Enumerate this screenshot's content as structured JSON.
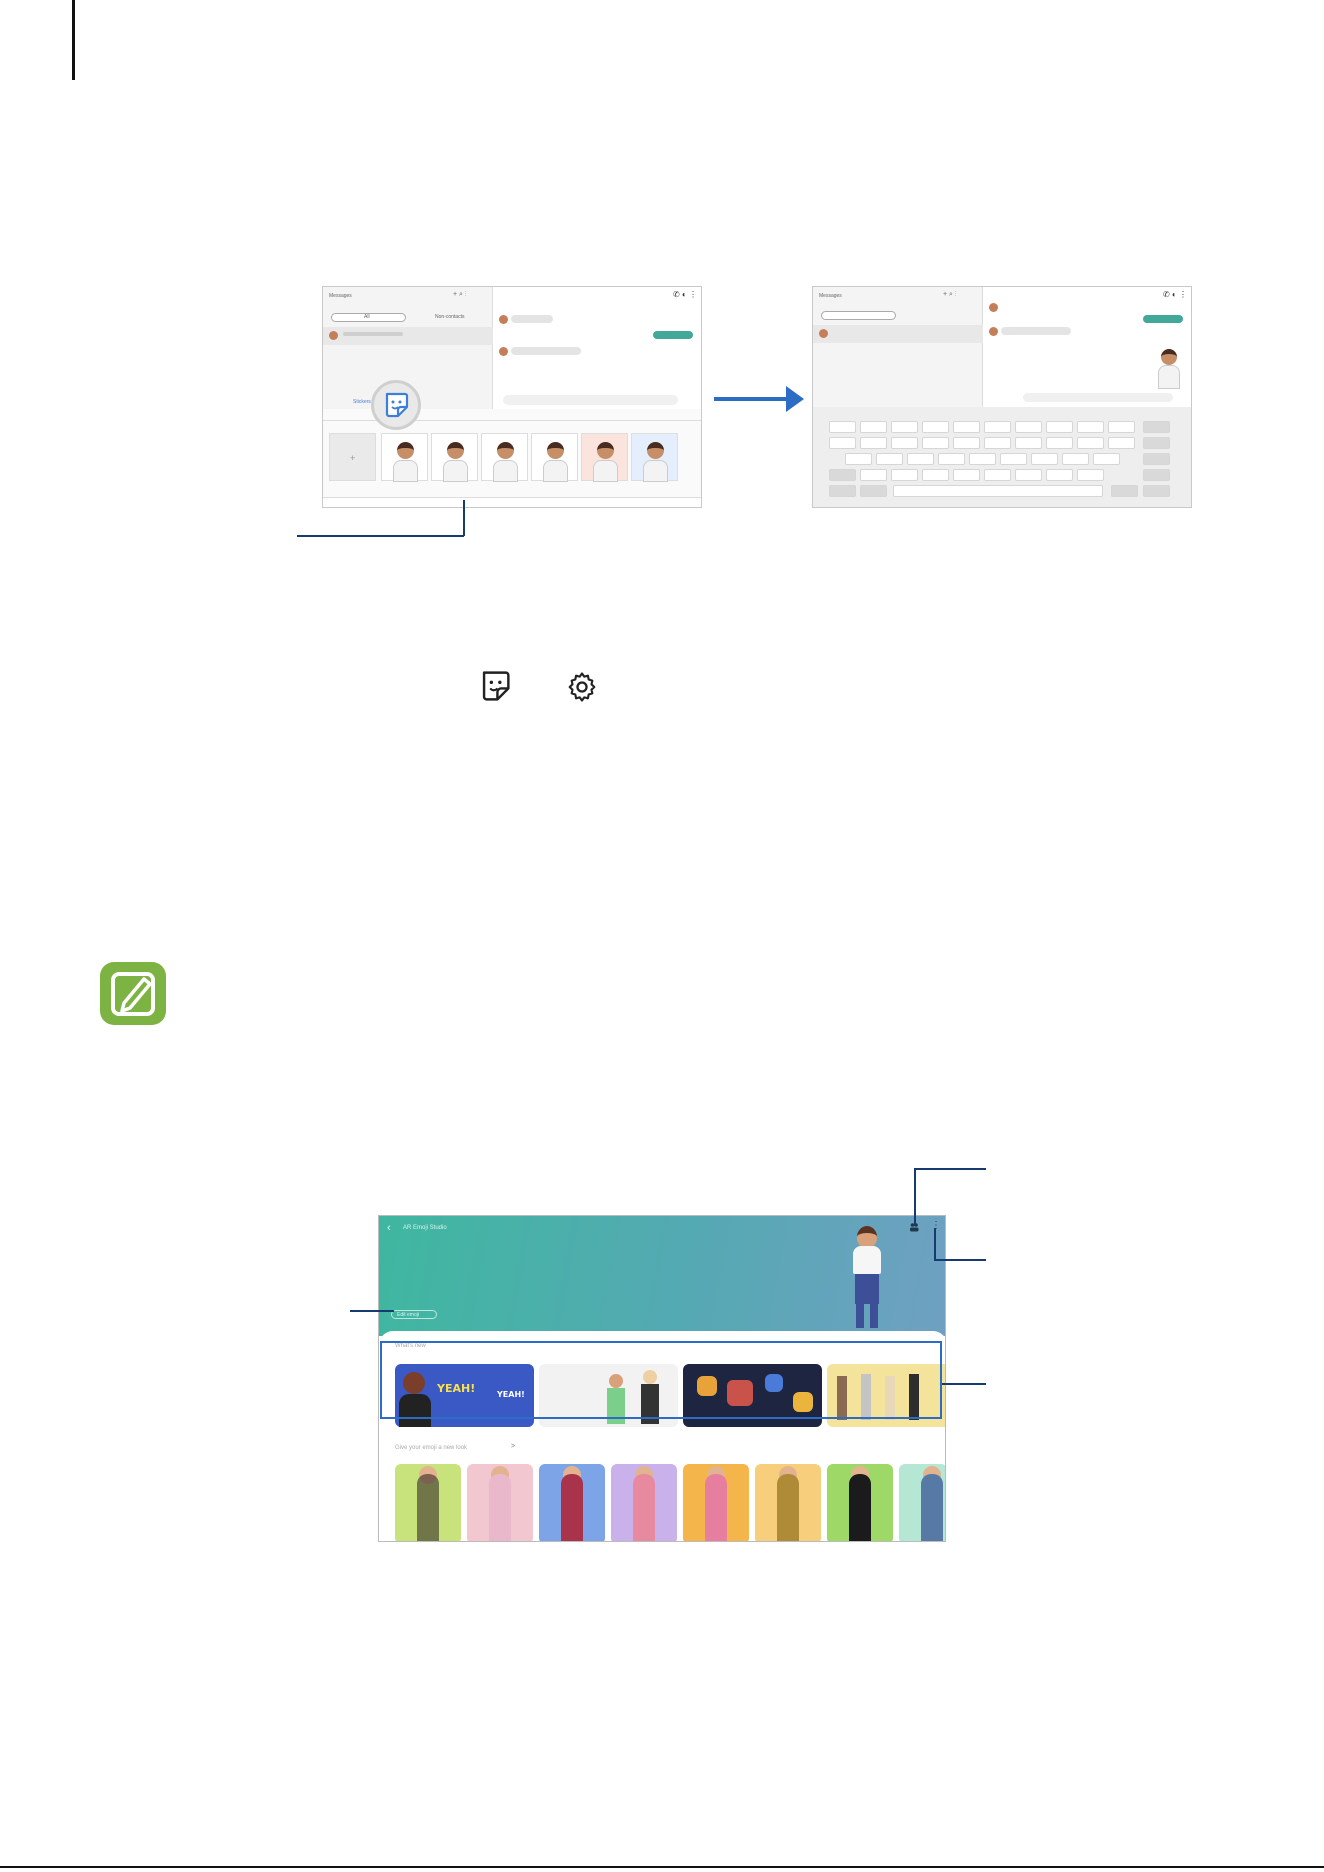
{
  "footer": {
    "text": ""
  },
  "messages_panel": {
    "title": "Messages",
    "tab_all": "All",
    "tab_unread": "Non-contacts",
    "attachment": "Stickers"
  },
  "stickers_panel": {
    "title": "Messages"
  },
  "ar_screen": {
    "title": "AR Emoji Studio",
    "edit_button": "Edit emoji",
    "whats_new_label": "What's new",
    "new_look_label": "Give your emoji a new look",
    "new_look_chevron": ">",
    "yeah_text": "YEAH!",
    "yeah_text_2": "YEAH!",
    "back_icon": "back-icon",
    "more_icon": "more-icon"
  },
  "icons": {
    "sticker_icon": "sticker-icon",
    "settings_icon": "settings-icon",
    "note_icon": "note-icon"
  },
  "colors": {
    "arrow": "#2d6cc4",
    "callout": "#173b6e",
    "teal": "#41a89a",
    "note_green": "#7cb342"
  }
}
